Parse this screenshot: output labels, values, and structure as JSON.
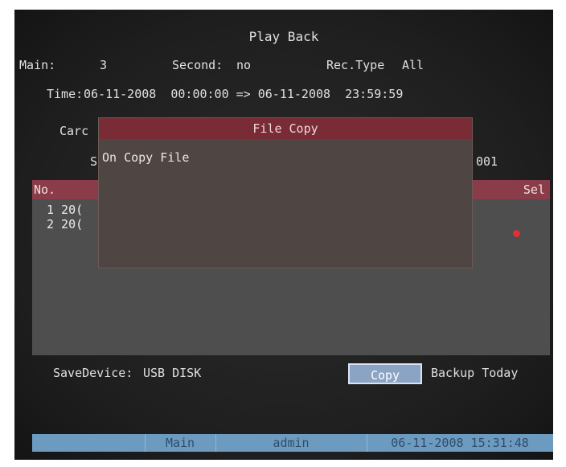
{
  "header": {
    "title": "Play Back",
    "main_label": "Main:",
    "main_value": "3",
    "second_label": "Second:",
    "second_value": "no",
    "rec_type_label": "Rec.Type",
    "rec_type_value": "All",
    "time_label": "Time:",
    "time_range": "06-11-2008  00:00:00 => 06-11-2008  23:59:59"
  },
  "background_partial": {
    "card_label": "Carc",
    "row_s": "S",
    "row_s_value": "001"
  },
  "list": {
    "columns": [
      "No.",
      "Sel"
    ],
    "rows": [
      {
        "text": "1 20("
      },
      {
        "text": "2 20("
      }
    ],
    "selected_indicator_color": "#e03030"
  },
  "dialog": {
    "title": "File Copy",
    "message": "On Copy File"
  },
  "footer": {
    "save_device_label": "SaveDevice:",
    "save_device_value": "USB DISK",
    "copy_button": "Copy",
    "backup_today_button": "Backup Today"
  },
  "statusbar": {
    "segments": [
      "",
      "Main",
      "admin",
      "06-11-2008 15:31:48"
    ]
  },
  "colors": {
    "accent_header": "#8a3d48",
    "dialog_title": "#7a2c36",
    "statusbar": "#6d9bbf",
    "button": "#8ca4c4"
  }
}
